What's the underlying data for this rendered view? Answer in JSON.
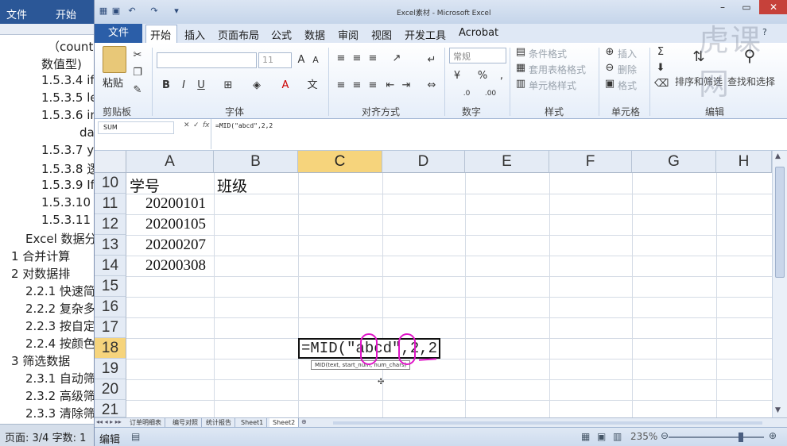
{
  "word": {
    "tabs": [
      "文件",
      "开始"
    ],
    "lines": [
      "（count(",
      "数值型)",
      "1.5.3.4 if",
      "1.5.3.5 le",
      "1.5.3.6 in",
      "da",
      "1.5.3.7 ye",
      "1.5.3.8 逻",
      "1.5.3.9 Ife",
      "1.5.3.10",
      "1.5.3.11",
      "Excel 数据分",
      "1    合并计算",
      "2    对数据排",
      "2.2.1  快速简",
      "2.2.2  复杂多",
      "2.2.3  按自定",
      "2.2.4  按颜色",
      "3    筛选数据",
      "2.3.1  自动筛",
      "2.3.2  高级筛",
      "2.3.3  清除筛"
    ],
    "status": "页面: 3/4   字数: 1"
  },
  "excel": {
    "title": "Excel素材 - Microsoft Excel",
    "tabs": [
      "文件",
      "开始",
      "插入",
      "页面布局",
      "公式",
      "数据",
      "审阅",
      "视图",
      "开发工具",
      "Acrobat"
    ],
    "ribbon": {
      "paste": "粘贴",
      "clipboard": "剪贴板",
      "font": "字体",
      "alignment": "对齐方式",
      "number_format": "常规",
      "number": "数字",
      "conditional": "条件格式",
      "table_format": "套用表格格式",
      "cell_style": "单元格样式",
      "styles": "样式",
      "insert": "插入",
      "delete": "删除",
      "format": "格式",
      "cells": "单元格",
      "sort_filter": "排序和筛选",
      "find_select": "查找和选择",
      "editing": "编辑",
      "font_size": "11"
    },
    "name_box": "SUM",
    "formula": "=MID(\"abcd\",2,2",
    "columns": [
      "A",
      "B",
      "C",
      "D",
      "E",
      "F",
      "G",
      "H"
    ],
    "rows": [
      "10",
      "11",
      "12",
      "13",
      "14",
      "15",
      "16",
      "17",
      "18",
      "19",
      "20",
      "21"
    ],
    "cells": {
      "A10": "学号",
      "B10": "班级",
      "A11": "20200101",
      "A12": "20200105",
      "A13": "20200207",
      "A14": "20200308"
    },
    "active_cell_text": "=MID(\"abcd\",2,2",
    "tooltip": "MID(text, start_num, num_chars)",
    "sheets": [
      "订单明细表",
      "编号对照",
      "统计报告",
      "Sheet1",
      "Sheet2"
    ],
    "status": "编辑",
    "zoom": "235%",
    "watermark": "虎课网"
  }
}
